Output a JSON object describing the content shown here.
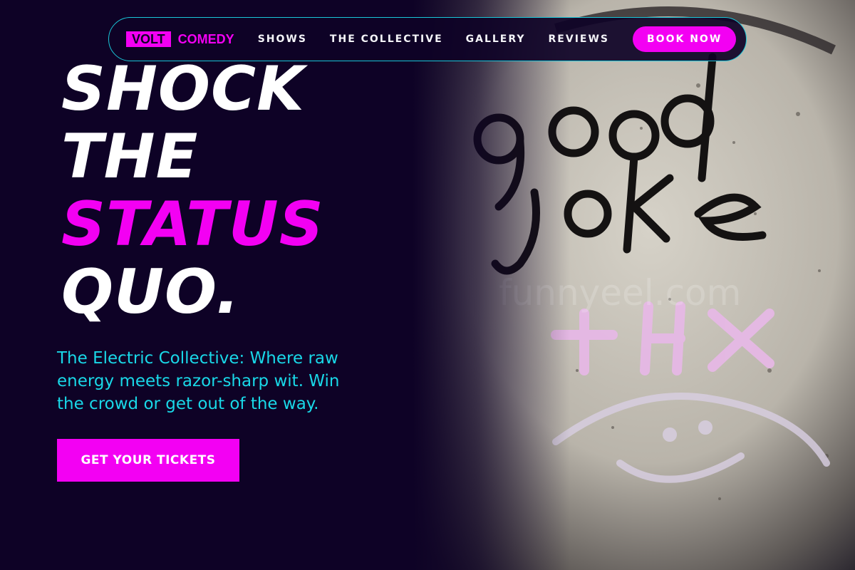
{
  "nav": {
    "logo_primary": "VOLT",
    "logo_secondary": "COMEDY",
    "links": [
      "SHOWS",
      "THE COLLECTIVE",
      "GALLERY",
      "REVIEWS"
    ],
    "cta_label": "BOOK NOW"
  },
  "hero": {
    "headline_lines": [
      "SHOCK",
      "THE",
      "STATUS",
      "QUO."
    ],
    "highlighted_line": "STATUS",
    "subtitle": "The Electric Collective: Where raw energy meets razor-sharp wit. Win the crowd or get out of the way.",
    "cta_label": "GET YOUR TICKETS",
    "image": {
      "description_graffiti": "good joke",
      "graffiti_secondary": "+HX",
      "watermark": "funnyeel.com"
    }
  },
  "colors": {
    "background": "#0e0226",
    "accent_pink": "#f300f3",
    "accent_cyan": "#19d8e8",
    "text_white": "#ffffff"
  }
}
